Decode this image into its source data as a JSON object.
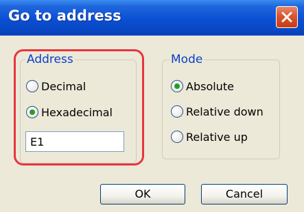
{
  "window": {
    "title": "Go to address",
    "close_icon": "close-icon"
  },
  "address_group": {
    "legend": "Address",
    "options": [
      {
        "label": "Decimal",
        "selected": false
      },
      {
        "label": "Hexadecimal",
        "selected": true
      }
    ],
    "input_value": "E1"
  },
  "mode_group": {
    "legend": "Mode",
    "options": [
      {
        "label": "Absolute",
        "selected": true
      },
      {
        "label": "Relative down",
        "selected": false
      },
      {
        "label": "Relative up",
        "selected": false
      }
    ]
  },
  "buttons": {
    "ok": "OK",
    "cancel": "Cancel"
  },
  "colors": {
    "title_bar": "#0a4fd4",
    "close_button": "#d9562f",
    "highlight": "#e8343e",
    "radio_dot": "#21a121",
    "legend": "#0a3ec8"
  }
}
